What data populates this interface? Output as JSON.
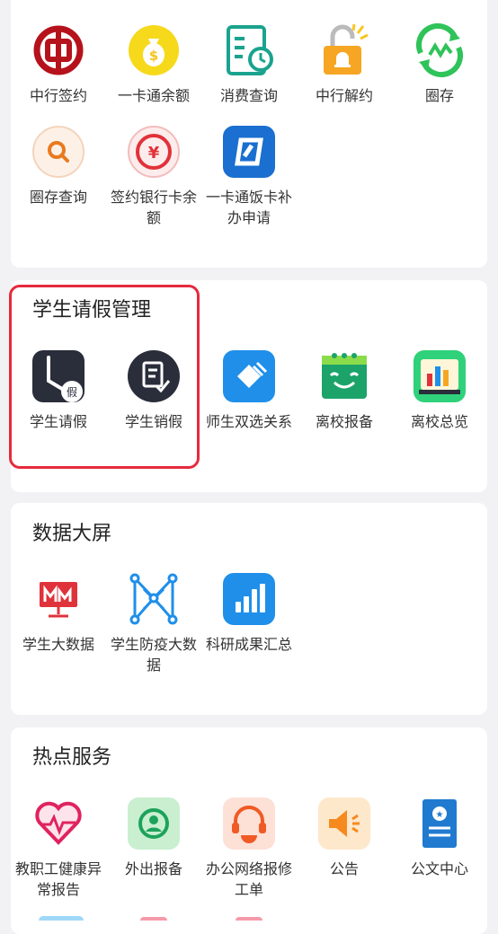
{
  "sections": {
    "finance": {
      "apps": [
        {
          "label": "中行签约",
          "icon": "bank-of-china-icon"
        },
        {
          "label": "一卡通余额",
          "icon": "money-bag-icon"
        },
        {
          "label": "消费查询",
          "icon": "receipt-clock-icon"
        },
        {
          "label": "中行解约",
          "icon": "unlock-bell-icon"
        },
        {
          "label": "圈存",
          "icon": "transfer-cycle-icon"
        },
        {
          "label": "圈存查询",
          "icon": "search-icon"
        },
        {
          "label": "签约银行卡余额",
          "icon": "yuan-coin-icon"
        },
        {
          "label": "一卡通饭卡补办申请",
          "icon": "card-reissue-icon"
        }
      ]
    },
    "leave": {
      "title": "学生请假管理",
      "apps": [
        {
          "label": "学生请假",
          "icon": "leave-clock-icon"
        },
        {
          "label": "学生销假",
          "icon": "document-check-icon"
        },
        {
          "label": "师生双选关系",
          "icon": "match-icon"
        },
        {
          "label": "离校报备",
          "icon": "calendar-smile-icon"
        },
        {
          "label": "离校总览",
          "icon": "bar-board-icon"
        }
      ]
    },
    "data_screen": {
      "title": "数据大屏",
      "apps": [
        {
          "label": "学生大数据",
          "icon": "monitor-chart-icon"
        },
        {
          "label": "学生防疫大数据",
          "icon": "network-nodes-icon"
        },
        {
          "label": "科研成果汇总",
          "icon": "bar-chart-icon"
        }
      ]
    },
    "hot": {
      "title": "热点服务",
      "apps": [
        {
          "label": "教职工健康异常报告",
          "icon": "heart-pulse-icon"
        },
        {
          "label": "外出报备",
          "icon": "person-circle-icon"
        },
        {
          "label": "办公网络报修工单",
          "icon": "headset-icon"
        },
        {
          "label": "公告",
          "icon": "megaphone-icon"
        },
        {
          "label": "公文中心",
          "icon": "document-badge-icon"
        }
      ]
    }
  },
  "colors": {
    "highlight": "#e62a3c",
    "card": "#ffffff",
    "background": "#f2f2f4"
  }
}
